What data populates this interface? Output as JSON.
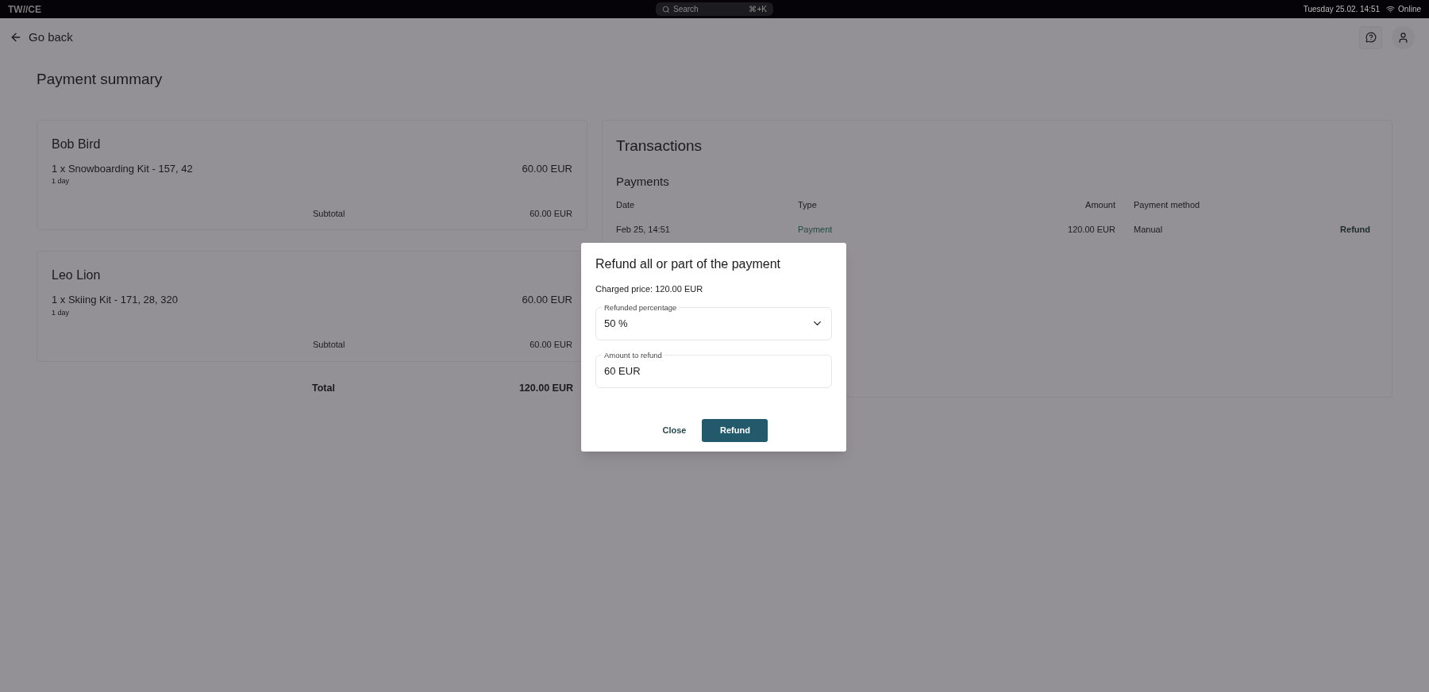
{
  "top_bar": {
    "logo": "TW//CE",
    "search": {
      "placeholder": "Search",
      "shortcut": "⌘+K"
    },
    "datetime": "Tuesday 25.02. 14:51",
    "connection": "Online"
  },
  "header": {
    "back": "Go back"
  },
  "page_title": "Payment summary",
  "customers": [
    {
      "name": "Bob Bird",
      "items": [
        {
          "label": "1 x Snowboarding Kit - 157, 42",
          "duration": "1 day",
          "price": "60.00 EUR"
        }
      ],
      "subtotal_label": "Subtotal",
      "subtotal": "60.00 EUR"
    },
    {
      "name": "Leo Lion",
      "items": [
        {
          "label": "1 x Skiing Kit - 171, 28, 320",
          "duration": "1 day",
          "price": "60.00 EUR"
        }
      ],
      "subtotal_label": "Subtotal",
      "subtotal": "60.00 EUR"
    }
  ],
  "total": {
    "label": "Total",
    "value": "120.00 EUR"
  },
  "transactions": {
    "title": "Transactions",
    "payments_title": "Payments",
    "columns": [
      "Date",
      "Type",
      "Amount",
      "Payment method"
    ],
    "rows": [
      {
        "date": "Feb 25, 14:51",
        "type": "Payment",
        "amount": "120.00 EUR",
        "method": "Manual",
        "action": "Refund"
      }
    ]
  },
  "dialog": {
    "title": "Refund all or part of the payment",
    "charged": "Charged price: 120.00 EUR",
    "fields": [
      {
        "kind": "select",
        "label": "Refunded percentage",
        "value": "50 %"
      },
      {
        "kind": "input",
        "label": "Amount to refund",
        "value": "60 EUR"
      }
    ],
    "buttons": [
      {
        "kind": "text",
        "label": "Close"
      },
      {
        "kind": "primary",
        "label": "Refund"
      }
    ]
  }
}
